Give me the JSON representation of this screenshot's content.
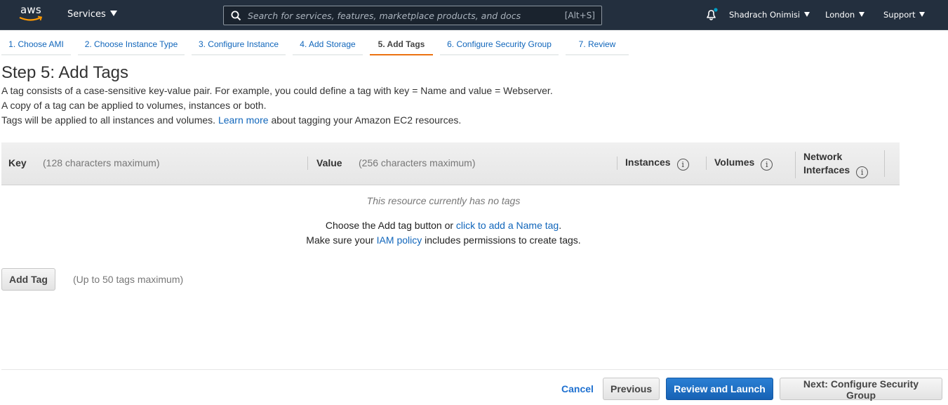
{
  "topnav": {
    "logo": "aws",
    "services_label": "Services",
    "search": {
      "placeholder": "Search for services, features, marketplace products, and docs",
      "value": "",
      "shortcut": "[Alt+S]"
    },
    "notification_icon": "bell-icon",
    "notification_dot_color": "#00a1c9",
    "user_label": "Shadrach Onimisi",
    "region_label": "London",
    "support_label": "Support"
  },
  "wizard": {
    "tabs": [
      {
        "label": "1. Choose AMI",
        "active": false
      },
      {
        "label": "2. Choose Instance Type",
        "active": false
      },
      {
        "label": "3. Configure Instance",
        "active": false
      },
      {
        "label": "4. Add Storage",
        "active": false
      },
      {
        "label": "5. Add Tags",
        "active": true
      },
      {
        "label": "6. Configure Security Group",
        "active": false
      },
      {
        "label": "7. Review",
        "active": false
      }
    ],
    "active_color": "#ec7211"
  },
  "main": {
    "title": "Step 5: Add Tags",
    "desc_line1": "A tag consists of a case-sensitive key-value pair. For example, you could define a tag with key = Name and value = Webserver.",
    "desc_line2": "A copy of a tag can be applied to volumes, instances or both.",
    "desc_line3_before": "Tags will be applied to all instances and volumes.",
    "desc_line3_link": "Learn more",
    "desc_line3_after": "about tagging your Amazon EC2 resources."
  },
  "table": {
    "columns": {
      "key": {
        "label": "Key",
        "hint": "(128 characters maximum)"
      },
      "value": {
        "label": "Value",
        "hint": "(256 characters maximum)"
      },
      "instances": {
        "label": "Instances"
      },
      "volumes": {
        "label": "Volumes"
      },
      "network_interfaces": {
        "label_line1": "Network",
        "label_line2": "Interfaces"
      }
    },
    "info_glyph": "i",
    "empty_message": "This resource currently has no tags",
    "hint1_before": "Choose the Add tag button or",
    "hint1_link": "click to add a Name tag",
    "hint1_after": ".",
    "hint2_before": "Make sure your",
    "hint2_link": "IAM policy",
    "hint2_after": "includes permissions to create tags."
  },
  "add_tag": {
    "button_label": "Add Tag",
    "note": "(Up to 50 tags maximum)"
  },
  "footer": {
    "cancel_label": "Cancel",
    "previous_label": "Previous",
    "review_label": "Review and Launch",
    "next_label": "Next: Configure Security Group",
    "primary_color": "#1a6bc4"
  }
}
